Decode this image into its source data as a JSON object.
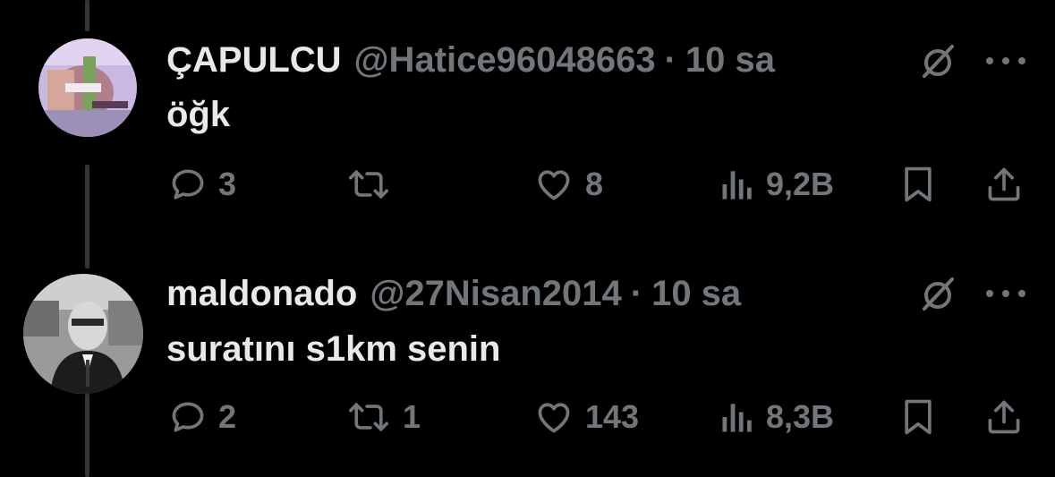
{
  "tweets": [
    {
      "display_name": "ÇAPULCU",
      "handle": "@Hatice96048663",
      "separator": "·",
      "time": "10 sa",
      "text": "öğk",
      "replies": "3",
      "retweets": "",
      "likes": "8",
      "views": "9,2B"
    },
    {
      "display_name": "maldonado",
      "handle": "@27Nisan2014",
      "separator": "·",
      "time": "10 sa",
      "text": "suratını s1km senin",
      "replies": "2",
      "retweets": "1",
      "likes": "143",
      "views": "8,3B"
    }
  ],
  "icons": {
    "reply": "reply-icon",
    "retweet": "retweet-icon",
    "like": "heart-icon",
    "views": "views-icon",
    "bookmark": "bookmark-icon",
    "share": "share-icon",
    "grok": "grok-icon",
    "more": "more-icon"
  },
  "colors": {
    "background": "#000000",
    "primary_text": "#e7e9ea",
    "secondary_text": "#71767b",
    "thread_line": "#333639"
  }
}
